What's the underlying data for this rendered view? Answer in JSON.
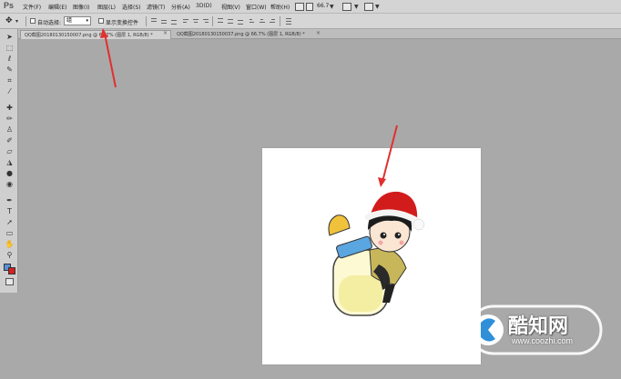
{
  "app": {
    "logo": "Ps"
  },
  "menu": [
    "文件(F)",
    "编辑(E)",
    "图像(I)",
    "图层(L)",
    "选择(S)",
    "滤镜(T)",
    "分析(A)",
    "3D(D)",
    "视图(V)",
    "窗口(W)",
    "帮助(H)"
  ],
  "menubar_controls": {
    "zoom": "66.7"
  },
  "options": {
    "move_tool_icon": "move-tool-icon",
    "auto_select_label": "自动选择:",
    "auto_select_value": "组",
    "show_transform_label": "显示变换控件"
  },
  "tabs": [
    {
      "label": "QQ截图20180130150007.png @ 66.7% (图层 1, RGB/8) *",
      "active": true
    },
    {
      "label": "QQ截图20180130150037.png @ 66.7% (图层 1, RGB/8) *",
      "active": false
    }
  ],
  "colors": {
    "foreground": "#5b8fd6",
    "background": "#d42020",
    "arrow": "#e03030"
  },
  "watermark": {
    "title": "酷知网",
    "url": "www.coozhi.com"
  }
}
